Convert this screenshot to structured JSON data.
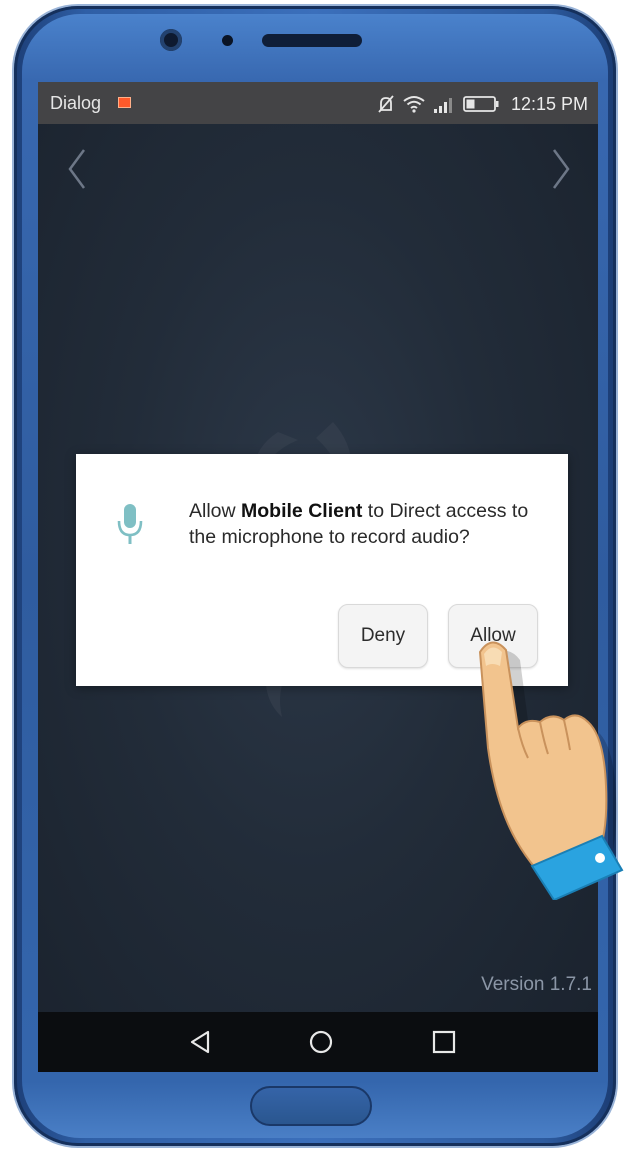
{
  "status_bar": {
    "carrier": "Dialog",
    "time": "12:15 PM",
    "icons": [
      "sim-card-icon",
      "mute-icon",
      "wifi-icon",
      "signal-icon",
      "battery-icon"
    ]
  },
  "app": {
    "version": "Version 1.7.1"
  },
  "dialog": {
    "message_prefix": "Allow ",
    "app_name": "Mobile Client",
    "message_suffix": " to Direct access to the microphone to record audio?",
    "deny_label": "Deny",
    "allow_label": "Allow",
    "icon": "microphone-icon",
    "icon_color": "#7fbfc4"
  },
  "navigation_bar": {
    "buttons": [
      "back-icon",
      "home-icon",
      "recents-icon"
    ]
  },
  "colors": {
    "phone_frame": "#2f5fa6",
    "status_bar": "#444446",
    "screen_bg": "#222c39",
    "cuff": "#2aa3e0",
    "hand": "#f2c48e"
  }
}
